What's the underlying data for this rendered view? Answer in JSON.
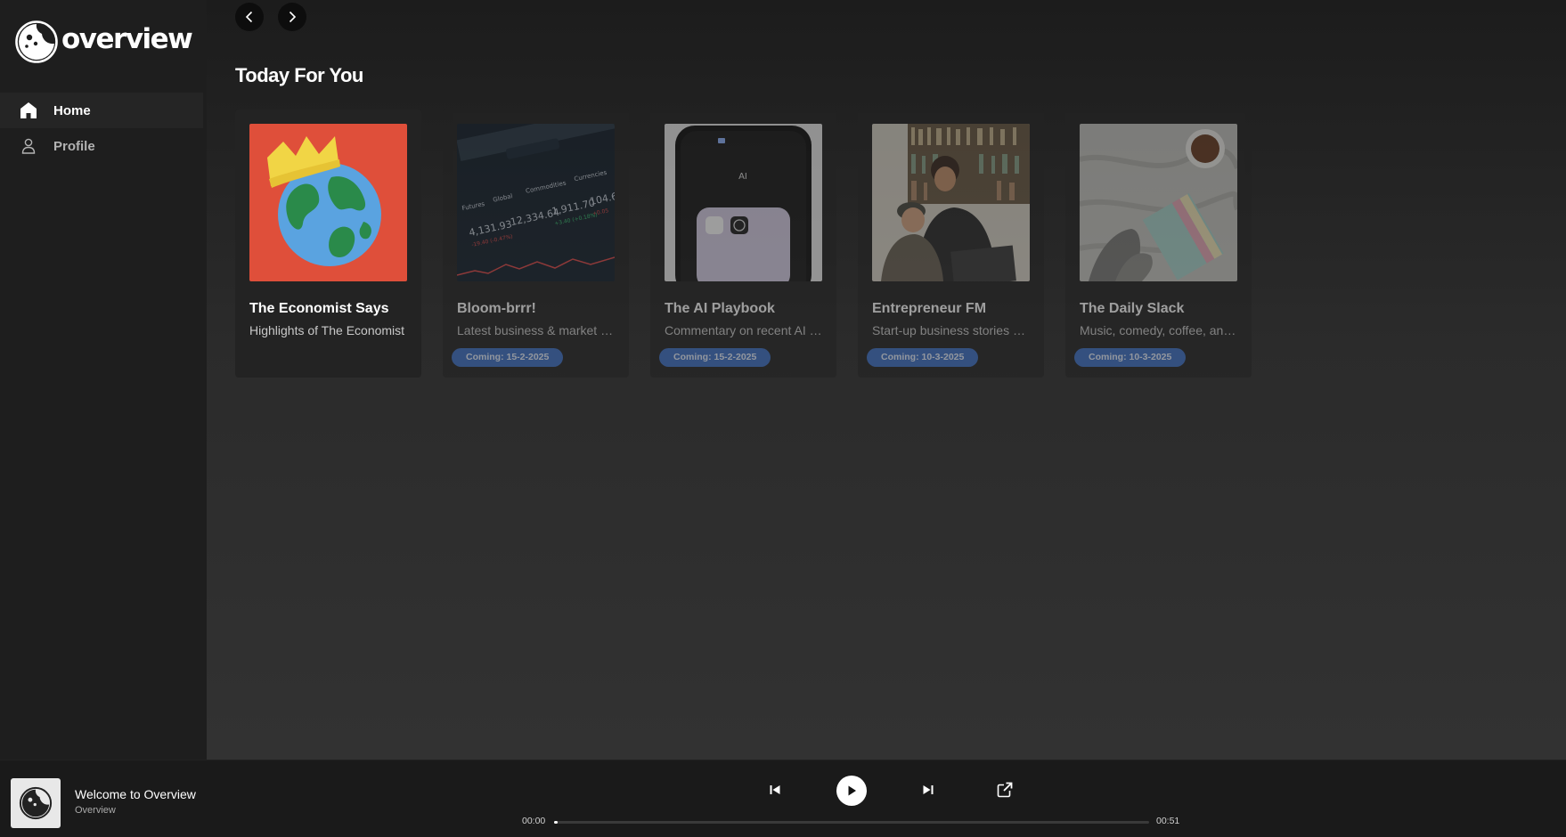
{
  "brand": {
    "name": "overview"
  },
  "sidebar": {
    "items": [
      {
        "label": "Home",
        "icon": "home-icon",
        "active": true
      },
      {
        "label": "Profile",
        "icon": "user-icon",
        "active": false
      }
    ]
  },
  "main": {
    "section_title": "Today For You",
    "cards": [
      {
        "title": "The Economist Says",
        "description": "Highlights of The Economist",
        "badge": "",
        "art": "crowned-globe"
      },
      {
        "title": "Bloom-brrr!",
        "description": "Latest business & market insights",
        "badge": "Coming: 15-2-2025",
        "art": "stock-screen"
      },
      {
        "title": "The AI Playbook",
        "description": "Commentary on recent AI trends",
        "badge": "Coming: 15-2-2025",
        "art": "phone-ai"
      },
      {
        "title": "Entrepreneur FM",
        "description": "Start-up business stories and more",
        "badge": "Coming: 10-3-2025",
        "art": "people-laptop"
      },
      {
        "title": "The Daily Slack",
        "description": "Music, comedy, coffee, and more",
        "badge": "Coming: 10-3-2025",
        "art": "blanket-coffee"
      }
    ]
  },
  "player": {
    "track_title": "Welcome to Overview",
    "track_subtitle": "Overview",
    "current_time": "00:00",
    "total_time": "00:51",
    "progress": 0.004
  },
  "colors": {
    "accent": "#3d6fc4",
    "background": "#121212",
    "sidebar": "#1e1e1e"
  }
}
